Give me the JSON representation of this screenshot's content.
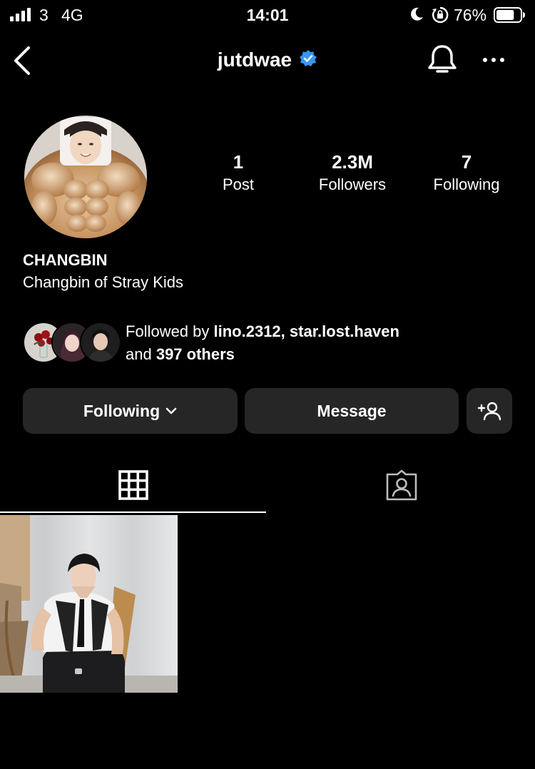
{
  "status_bar": {
    "carrier": "3",
    "network": "4G",
    "time": "14:01",
    "battery_percent": "76%",
    "battery_level": 0.76
  },
  "nav": {
    "username": "jutdwae",
    "verified": true,
    "icons": [
      "back-arrow-icon",
      "verified-badge-icon",
      "bell-icon",
      "more-icon"
    ]
  },
  "profile": {
    "stats": [
      {
        "value": "1",
        "label": "Post"
      },
      {
        "value": "2.3M",
        "label": "Followers"
      },
      {
        "value": "7",
        "label": "Following"
      }
    ],
    "name": "CHANGBIN",
    "bio": "Changbin of Stray Kids",
    "followed_by": {
      "prefix": "Followed by ",
      "user1": "lino.2312",
      "separator": ", ",
      "user2": "star.lost.haven",
      "and": "and ",
      "others": "397 others"
    }
  },
  "buttons": {
    "following": "Following",
    "message": "Message"
  },
  "tabs": [
    "grid-icon",
    "tagged-icon"
  ],
  "colors": {
    "background": "#000000",
    "button": "#262626",
    "verified": "#3897f0"
  }
}
